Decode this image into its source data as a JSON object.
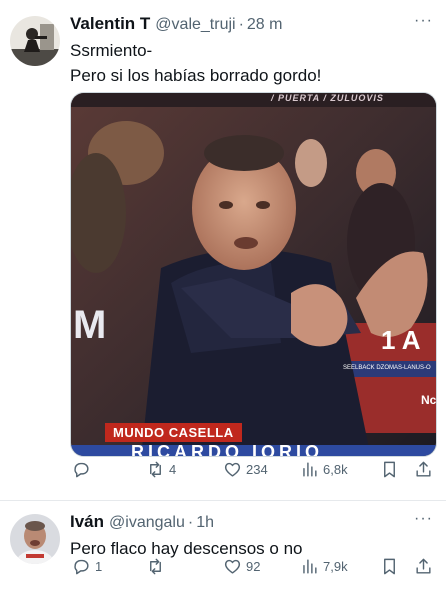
{
  "tweets": [
    {
      "name": "Valentin T",
      "handle": "@vale_truji",
      "time": "28 m",
      "more": "···",
      "lines": [
        "Ssrmiento-",
        "Pero si los habías borrado gordo!"
      ],
      "media": {
        "top_banner": "/ PUERTA / ZULUOVIS",
        "side_letter": "M",
        "red_banner": "1 A",
        "ticker": "SEELBACK DZOMAS-LANUS-O",
        "corner": "Nc",
        "caption": "MUNDO CASELLA",
        "strip": "RICARDO IORIO"
      },
      "stats": {
        "replies": "",
        "retweets": "4",
        "likes": "234",
        "views": "6,8k"
      }
    },
    {
      "name": "Iván",
      "handle": "@ivangalu",
      "time": "1h",
      "more": "···",
      "lines": [
        "Pero flaco hay descensos o no"
      ],
      "stats": {
        "replies": "1",
        "retweets": "",
        "likes": "92",
        "views": "7,9k"
      }
    }
  ],
  "icons": {
    "reply": "reply-icon",
    "retweet": "retweet-icon",
    "like": "heart-icon",
    "views": "views-icon",
    "bookmark": "bookmark-icon",
    "share": "share-icon"
  },
  "colors": {
    "text": "#0f1419",
    "secondary": "#536471",
    "divider": "#e6e9ec",
    "caption_red": "#c0281d"
  }
}
